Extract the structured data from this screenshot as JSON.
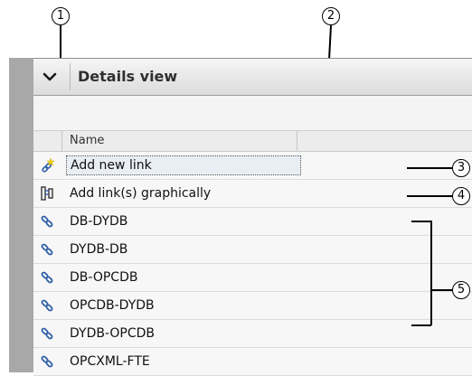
{
  "callouts": [
    "1",
    "2",
    "3",
    "4",
    "5"
  ],
  "panel": {
    "title": "Details view",
    "chevron_icon": "chevron-down-icon"
  },
  "table": {
    "columns": [
      "Name"
    ],
    "rows": [
      {
        "label": "Add new link",
        "icon": "add-link-star-icon",
        "selected": true
      },
      {
        "label": "Add link(s) graphically",
        "icon": "graphical-link-icon"
      },
      {
        "label": "DB-DYDB",
        "icon": "link-icon"
      },
      {
        "label": "DYDB-DB",
        "icon": "link-icon"
      },
      {
        "label": "DB-OPCDB",
        "icon": "link-icon"
      },
      {
        "label": "OPCDB-DYDB",
        "icon": "link-icon"
      },
      {
        "label": "DYDB-OPCDB",
        "icon": "link-icon"
      },
      {
        "label": "OPCXML-FTE",
        "icon": "link-icon"
      }
    ]
  }
}
